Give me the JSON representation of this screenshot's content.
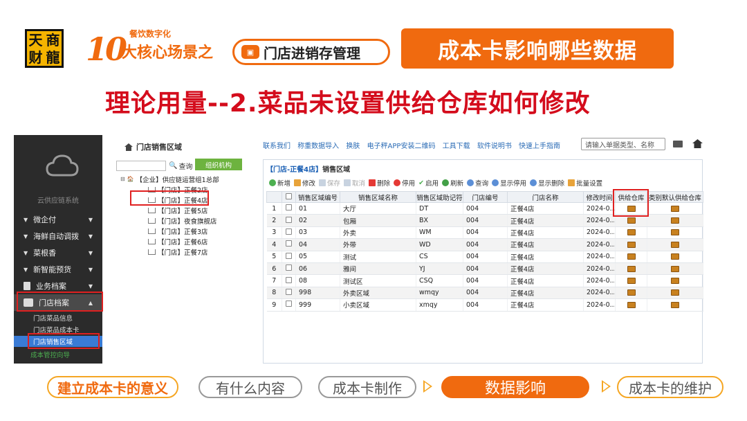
{
  "header": {
    "logo_chars": [
      "天",
      "商",
      "财",
      "龍"
    ],
    "ten_mark": "10",
    "digital_tag": "餐饮数字化",
    "core_scene": "大核心场景之",
    "scene_name": "门店进销存管理",
    "banner": "成本卡影响哪些数据",
    "subtitle": "理论用量--2.菜品未设置供给仓库如何修改"
  },
  "sidebar": {
    "system_name": "云供应链系统",
    "items": [
      {
        "label": "微企付"
      },
      {
        "label": "海鲜自动调拨"
      },
      {
        "label": "菜根香"
      },
      {
        "label": "新智能预货"
      },
      {
        "label": "业务档案"
      },
      {
        "label": "门店档案"
      }
    ],
    "sub_items": [
      {
        "label": "门店菜品信息"
      },
      {
        "label": "门店菜品成本卡"
      },
      {
        "label": "门店销售区域"
      },
      {
        "label": "成本管控向导"
      }
    ]
  },
  "tree_panel": {
    "breadcrumb": "门店销售区域",
    "search_label": "查询",
    "org_tab": "组织机构",
    "nodes": [
      {
        "label": "【企业】供应链运营组1总部"
      },
      {
        "label": "【门店】正餐2店"
      },
      {
        "label": "【门店】正餐4店"
      },
      {
        "label": "【门店】正餐5店"
      },
      {
        "label": "【门店】夜食旗舰店"
      },
      {
        "label": "【门店】正餐3店"
      },
      {
        "label": "【门店】正餐6店"
      },
      {
        "label": "【门店】正餐7店"
      }
    ]
  },
  "topbar": {
    "links": [
      "联系我们",
      "称重数据导入",
      "换肤",
      "电子秤APP安装二维码",
      "工具下载",
      "软件说明书",
      "快速上手指南"
    ],
    "search_placeholder": "请输入单据类型、名称"
  },
  "grid": {
    "title_store": "【门店-正餐4店】",
    "title_rest": "销售区域",
    "toolbar": [
      "新增",
      "修改",
      "保存",
      "取消",
      "删除",
      "停用",
      "启用",
      "刷新",
      "查询",
      "显示停用",
      "显示删除",
      "批量设置"
    ],
    "columns": [
      "",
      "",
      "销售区域编号",
      "销售区域名称",
      "销售区域助记符",
      "门店编号",
      "门店名称",
      "修改时间",
      "供给仓库",
      "类别默认供给仓库"
    ],
    "rows": [
      {
        "idx": "1",
        "code": "01",
        "name": "大厅",
        "mnemonic": "DT",
        "store_code": "004",
        "store_name": "正餐4店",
        "modified": "2024-0..."
      },
      {
        "idx": "2",
        "code": "02",
        "name": "包厢",
        "mnemonic": "BX",
        "store_code": "004",
        "store_name": "正餐4店",
        "modified": "2024-0..."
      },
      {
        "idx": "3",
        "code": "03",
        "name": "外卖",
        "mnemonic": "WM",
        "store_code": "004",
        "store_name": "正餐4店",
        "modified": "2024-0..."
      },
      {
        "idx": "4",
        "code": "04",
        "name": "外带",
        "mnemonic": "WD",
        "store_code": "004",
        "store_name": "正餐4店",
        "modified": "2024-0..."
      },
      {
        "idx": "5",
        "code": "05",
        "name": "测试",
        "mnemonic": "CS",
        "store_code": "004",
        "store_name": "正餐4店",
        "modified": "2024-0..."
      },
      {
        "idx": "6",
        "code": "06",
        "name": "雅间",
        "mnemonic": "YJ",
        "store_code": "004",
        "store_name": "正餐4店",
        "modified": "2024-0..."
      },
      {
        "idx": "7",
        "code": "08",
        "name": "测试区",
        "mnemonic": "CSQ",
        "store_code": "004",
        "store_name": "正餐4店",
        "modified": "2024-0..."
      },
      {
        "idx": "8",
        "code": "998",
        "name": "外卖区域",
        "mnemonic": "wmqy",
        "store_code": "004",
        "store_name": "正餐4店",
        "modified": "2024-0..."
      },
      {
        "idx": "9",
        "code": "999",
        "name": "小卖区域",
        "mnemonic": "xmqy",
        "store_code": "004",
        "store_name": "正餐4店",
        "modified": "2024-0..."
      }
    ]
  },
  "bottom_nav": [
    "建立成本卡的意义",
    "有什么内容",
    "成本卡制作",
    "数据影响",
    "成本卡的维护"
  ],
  "colors": {
    "accent": "#f06a0f",
    "subtitle_red": "#d40c1c",
    "highlight_box": "#e02020",
    "sidebar_bg": "#2b2b2b",
    "org_tab": "#6db33f"
  },
  "icons": [
    "cloud-icon",
    "home-icon",
    "search-icon",
    "keyboard-icon",
    "warehouse-box-icon",
    "cart-icon"
  ]
}
